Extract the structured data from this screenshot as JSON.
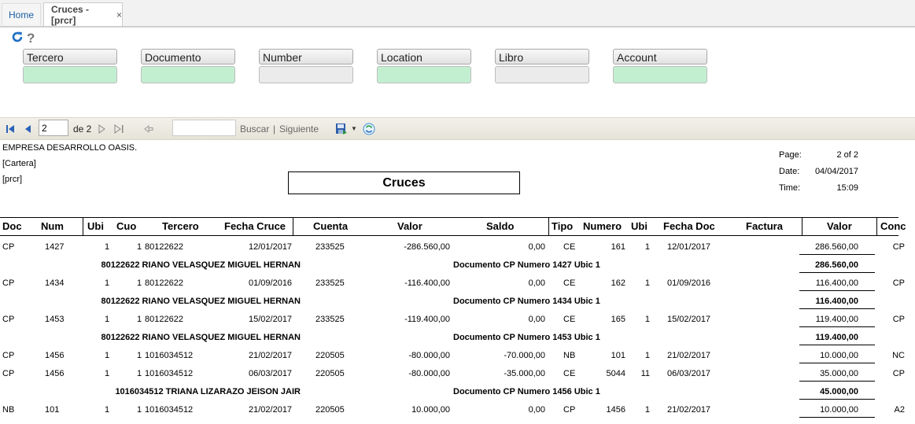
{
  "tabs": {
    "home": "Home",
    "active": "Cruces -[prcr]",
    "close": "×"
  },
  "toolbar_top": {
    "refresh_icon": "refresh-icon",
    "help_icon": "help-icon"
  },
  "fields": [
    {
      "label": "Tercero",
      "state": "green"
    },
    {
      "label": "Documento",
      "state": "green"
    },
    {
      "label": "Number",
      "state": "gray"
    },
    {
      "label": "Location",
      "state": "green"
    },
    {
      "label": "Libro",
      "state": "gray"
    },
    {
      "label": "Account",
      "state": "green"
    }
  ],
  "pager": {
    "page_value": "2",
    "of_label": "de 2",
    "buscar": "Buscar",
    "separator": "|",
    "siguiente": "Siguiente"
  },
  "report": {
    "company": "EMPRESA DESARROLLO OASIS.",
    "module": "[Cartera]",
    "code": "[prcr]",
    "title": "Cruces",
    "page_label": "Page:",
    "page_value": "2 of 2",
    "date_label": "Date:",
    "date_value": "04/04/2017",
    "time_label": "Time:",
    "time_value": "15:09",
    "columns": [
      "Doc",
      "Num",
      "Ubi",
      "Cuo",
      "Tercero",
      "Fecha Cruce",
      "Cuenta",
      "Valor",
      "Saldo",
      "Tipo",
      "Numero",
      "Ubi",
      "Fecha Doc",
      "Factura",
      "Valor",
      "Conc"
    ],
    "rows": [
      {
        "type": "data",
        "doc": "CP",
        "num": "1427",
        "ubi": "1",
        "cuo": "1",
        "tercero": "80122622",
        "fecha": "12/01/2017",
        "cuenta": "233525",
        "valor": "-286.560,00",
        "saldo": "0,00",
        "tipo": "CE",
        "numero": "161",
        "ubi2": "1",
        "fechadoc": "12/01/2017",
        "factura": "",
        "valor2": "286.560,00",
        "conc": "CP"
      },
      {
        "type": "sub",
        "name": "80122622 RIANO VELASQUEZ MIGUEL HERNAN",
        "docinfo": "Documento CP  Numero 1427 Ubic 1",
        "total": "286.560,00"
      },
      {
        "type": "data",
        "doc": "CP",
        "num": "1434",
        "ubi": "1",
        "cuo": "1",
        "tercero": "80122622",
        "fecha": "01/09/2016",
        "cuenta": "233525",
        "valor": "-116.400,00",
        "saldo": "0,00",
        "tipo": "CE",
        "numero": "162",
        "ubi2": "1",
        "fechadoc": "01/09/2016",
        "factura": "",
        "valor2": "116.400,00",
        "conc": "CP"
      },
      {
        "type": "sub",
        "name": "80122622 RIANO VELASQUEZ MIGUEL HERNAN",
        "docinfo": "Documento CP  Numero 1434 Ubic 1",
        "total": "116.400,00"
      },
      {
        "type": "data",
        "doc": "CP",
        "num": "1453",
        "ubi": "1",
        "cuo": "1",
        "tercero": "80122622",
        "fecha": "15/02/2017",
        "cuenta": "233525",
        "valor": "-119.400,00",
        "saldo": "0,00",
        "tipo": "CE",
        "numero": "165",
        "ubi2": "1",
        "fechadoc": "15/02/2017",
        "factura": "",
        "valor2": "119.400,00",
        "conc": "CP"
      },
      {
        "type": "sub",
        "name": "80122622 RIANO VELASQUEZ MIGUEL HERNAN",
        "docinfo": "Documento CP  Numero 1453 Ubic 1",
        "total": "119.400,00"
      },
      {
        "type": "data",
        "doc": "CP",
        "num": "1456",
        "ubi": "1",
        "cuo": "1",
        "tercero": "1016034512",
        "fecha": "21/02/2017",
        "cuenta": "220505",
        "valor": "-80.000,00",
        "saldo": "-70.000,00",
        "tipo": "NB",
        "numero": "101",
        "ubi2": "1",
        "fechadoc": "21/02/2017",
        "factura": "",
        "valor2": "10.000,00",
        "conc": "NC"
      },
      {
        "type": "data",
        "doc": "CP",
        "num": "1456",
        "ubi": "1",
        "cuo": "1",
        "tercero": "1016034512",
        "fecha": "06/03/2017",
        "cuenta": "220505",
        "valor": "-80.000,00",
        "saldo": "-35.000,00",
        "tipo": "CE",
        "numero": "5044",
        "ubi2": "11",
        "fechadoc": "06/03/2017",
        "factura": "",
        "valor2": "35.000,00",
        "conc": "CP"
      },
      {
        "type": "sub",
        "name": "1016034512 TRIANA LIZARAZO JEISON JAIR",
        "docinfo": "Documento CP  Numero 1456 Ubic 1",
        "total": "45.000,00"
      },
      {
        "type": "data",
        "doc": "NB",
        "num": "101",
        "ubi": "1",
        "cuo": "1",
        "tercero": "1016034512",
        "fecha": "21/02/2017",
        "cuenta": "220505",
        "valor": "10.000,00",
        "saldo": "0,00",
        "tipo": "CP",
        "numero": "1456",
        "ubi2": "1",
        "fechadoc": "21/02/2017",
        "factura": "",
        "valor2": "10.000,00",
        "conc": "A2"
      }
    ]
  }
}
